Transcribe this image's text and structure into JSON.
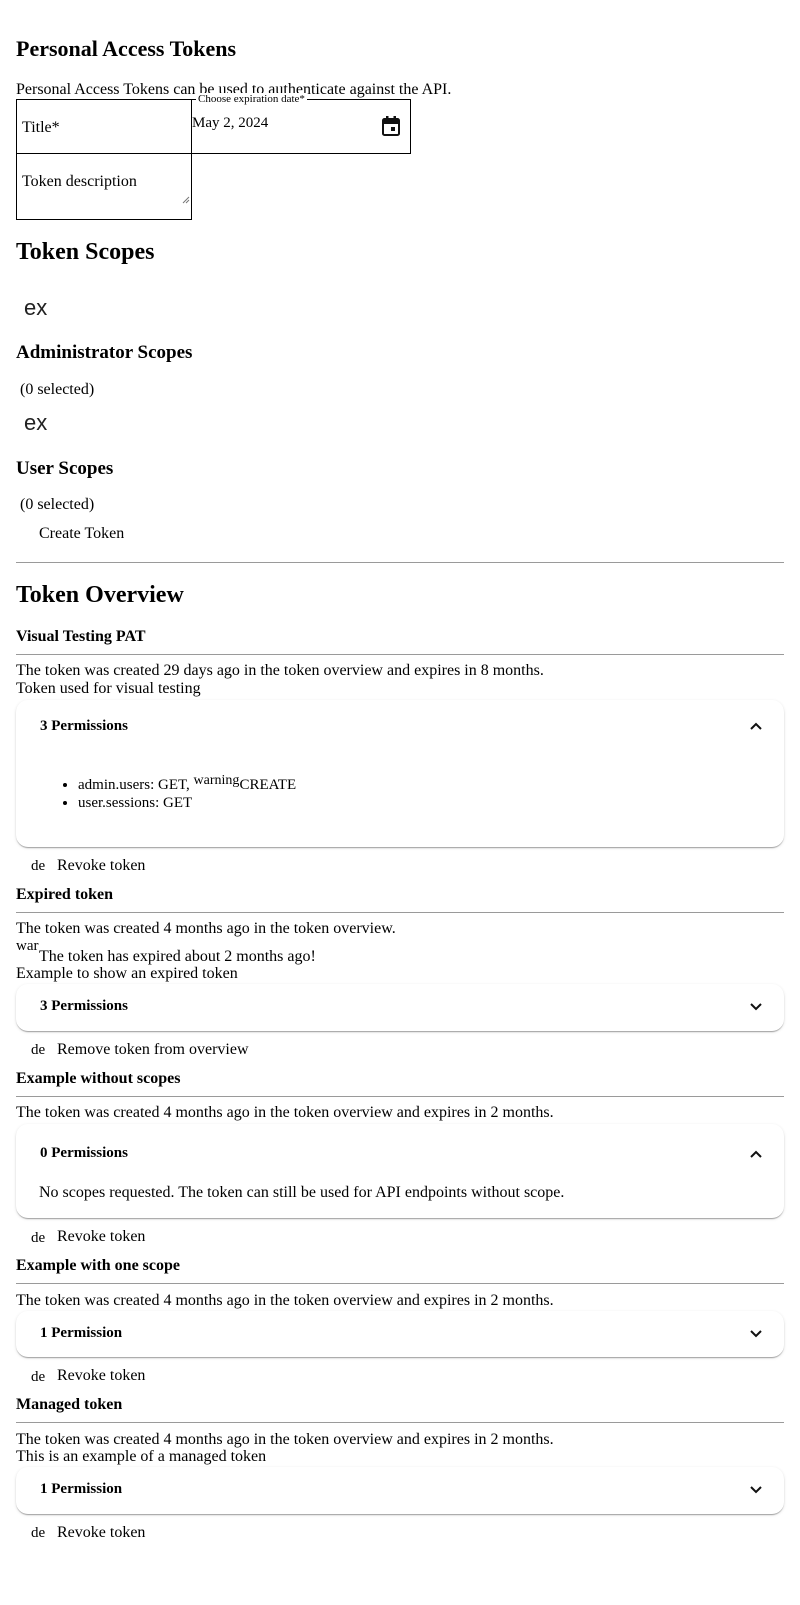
{
  "header": {
    "title": "Personal Access Tokens",
    "intro": "Personal Access Tokens can be used to authenticate against the API."
  },
  "form": {
    "title_label": "Title*",
    "expiration_label": "Choose expiration date*",
    "expiration_value": "May 2, 2024",
    "description_placeholder": "Token description"
  },
  "scopes": {
    "heading": "Token Scopes",
    "admin": {
      "expand_glyph": "ex",
      "heading": "Administrator Scopes",
      "selected": "(0 selected)"
    },
    "user": {
      "expand_glyph": "ex",
      "heading": "User Scopes",
      "selected": "(0 selected)"
    },
    "create_button": "Create Token"
  },
  "overview": {
    "heading": "Token Overview",
    "tokens": [
      {
        "name": "Visual Testing PAT",
        "created": "The token was created 29 days ago in the token overview and expires in 8 months.",
        "description": "Token used for visual testing",
        "permissions_label": "3 Permissions",
        "expanded": true,
        "perm_1_prefix": "admin.users: GET, ",
        "perm_1_icon": "warning",
        "perm_1_suffix": "CREATE",
        "perm_2": "user.sessions: GET",
        "action_icon": "de",
        "action": "Revoke token"
      },
      {
        "name": "Expired token",
        "created": "The token was created 4 months ago in the token overview.",
        "warning_icon": "war",
        "expired_note": "The token has expired about 2 months ago!",
        "description": "Example to show an expired token",
        "permissions_label": "3 Permissions",
        "expanded": false,
        "action_icon": "de",
        "action": "Remove token from overview"
      },
      {
        "name": "Example without scopes",
        "created": "The token was created 4 months ago in the token overview and expires in 2 months.",
        "permissions_label": "0 Permissions",
        "expanded": true,
        "no_scopes": "No scopes requested. The token can still be used for API endpoints without scope.",
        "action_icon": "de",
        "action": "Revoke token"
      },
      {
        "name": "Example with one scope",
        "created": "The token was created 4 months ago in the token overview and expires in 2 months.",
        "permissions_label": "1 Permission",
        "expanded": false,
        "action_icon": "de",
        "action": "Revoke token"
      },
      {
        "name": "Managed token",
        "created": "The token was created 4 months ago in the token overview and expires in 2 months.",
        "description": "This is an example of a managed token",
        "permissions_label": "1 Permission",
        "expanded": false,
        "action_icon": "de",
        "action": "Revoke token"
      }
    ]
  }
}
